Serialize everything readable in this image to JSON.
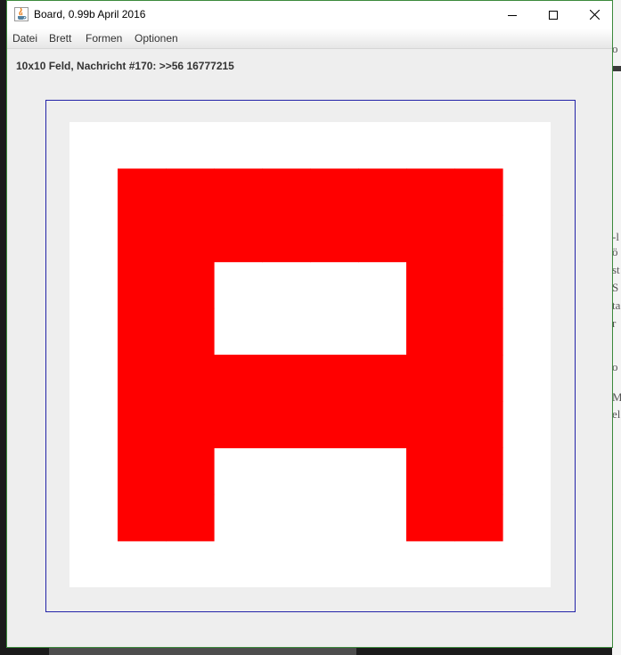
{
  "window": {
    "title": "Board, 0.99b April 2016",
    "icon": "java-cup-icon"
  },
  "menu": {
    "items": [
      "Datei",
      "Brett",
      "Formen",
      "Optionen"
    ]
  },
  "status": {
    "message": "10x10 Feld, Nachricht #170: >>56 16777215"
  },
  "board": {
    "size": 10,
    "background": "#ffffff",
    "fill_color": "#ff0000",
    "frame_color": "#2323a8",
    "red_cells": [
      [
        1,
        1
      ],
      [
        2,
        1
      ],
      [
        3,
        1
      ],
      [
        4,
        1
      ],
      [
        5,
        1
      ],
      [
        6,
        1
      ],
      [
        7,
        1
      ],
      [
        8,
        1
      ],
      [
        1,
        2
      ],
      [
        2,
        2
      ],
      [
        3,
        2
      ],
      [
        4,
        2
      ],
      [
        5,
        2
      ],
      [
        6,
        2
      ],
      [
        7,
        2
      ],
      [
        8,
        2
      ],
      [
        1,
        3
      ],
      [
        2,
        3
      ],
      [
        7,
        3
      ],
      [
        8,
        3
      ],
      [
        1,
        4
      ],
      [
        2,
        4
      ],
      [
        7,
        4
      ],
      [
        8,
        4
      ],
      [
        1,
        5
      ],
      [
        2,
        5
      ],
      [
        3,
        5
      ],
      [
        4,
        5
      ],
      [
        5,
        5
      ],
      [
        6,
        5
      ],
      [
        7,
        5
      ],
      [
        8,
        5
      ],
      [
        1,
        6
      ],
      [
        2,
        6
      ],
      [
        3,
        6
      ],
      [
        4,
        6
      ],
      [
        5,
        6
      ],
      [
        6,
        6
      ],
      [
        7,
        6
      ],
      [
        8,
        6
      ],
      [
        1,
        7
      ],
      [
        2,
        7
      ],
      [
        7,
        7
      ],
      [
        8,
        7
      ],
      [
        1,
        8
      ],
      [
        2,
        8
      ],
      [
        7,
        8
      ],
      [
        8,
        8
      ]
    ]
  },
  "background_window": {
    "fragments": [
      "o",
      "-l",
      "ö",
      "st",
      "S",
      "ta",
      "r",
      "o",
      "M",
      "el"
    ]
  }
}
